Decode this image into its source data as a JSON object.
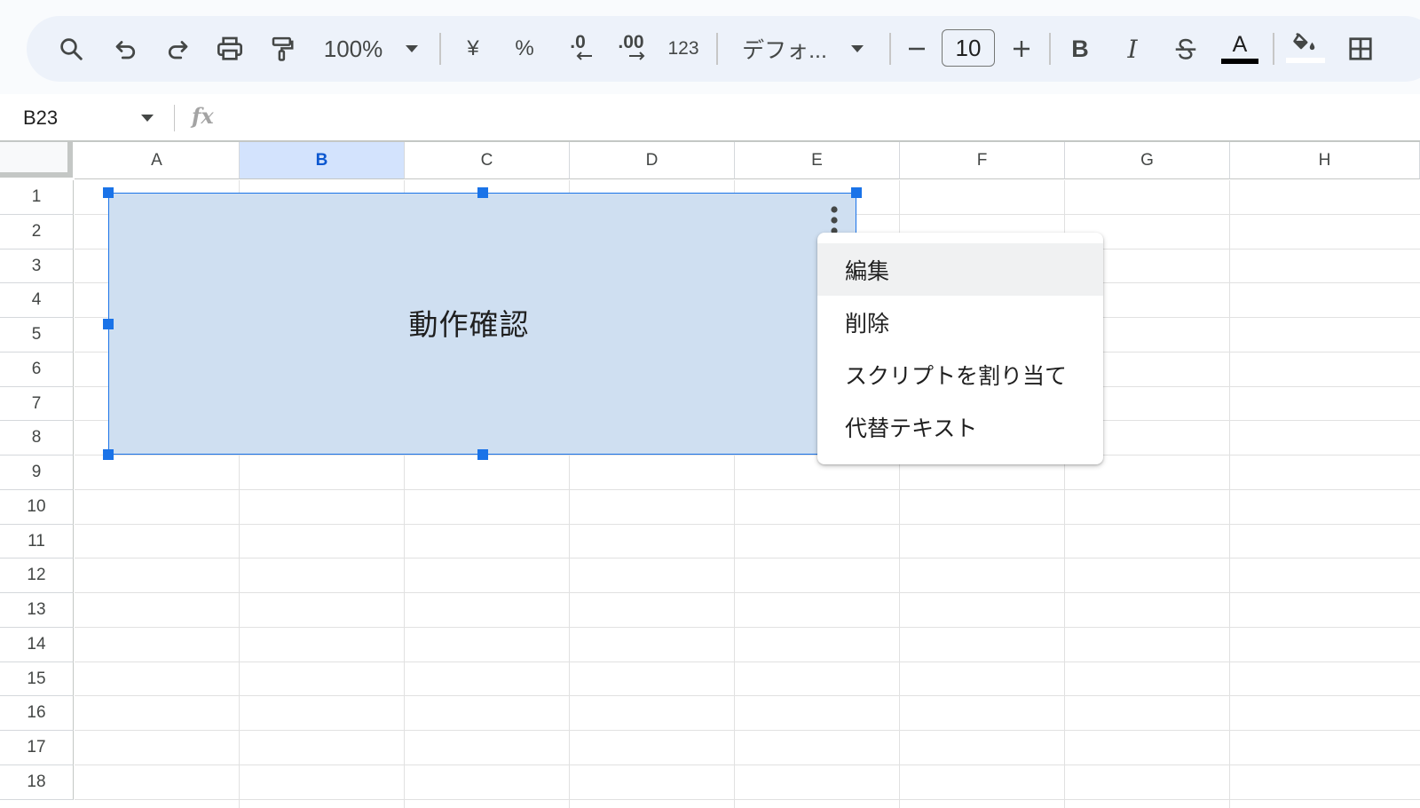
{
  "toolbar": {
    "zoom": "100%",
    "currency": "¥",
    "percent": "%",
    "decrease_decimal": ".0",
    "increase_decimal": ".00",
    "number_format": "123",
    "font": "デフォ...",
    "font_size": "10",
    "bold": "B",
    "italic": "I",
    "text_color_letter": "A",
    "text_color": "#000000",
    "fill_color": "#ffffff",
    "icons": [
      "search-icon",
      "undo-icon",
      "redo-icon",
      "print-icon",
      "paint-format-icon",
      "zoom-dropdown-icon",
      "font-dropdown-icon",
      "minus-icon",
      "plus-icon",
      "strikethrough-icon",
      "fill-color-icon",
      "borders-icon"
    ]
  },
  "formula_bar": {
    "name_box": "B23",
    "fx": "fx",
    "value": ""
  },
  "grid": {
    "columns": [
      "A",
      "B",
      "C",
      "D",
      "E",
      "F",
      "G",
      "H"
    ],
    "selected_column": "B",
    "rows": [
      "1",
      "2",
      "3",
      "4",
      "5",
      "6",
      "7",
      "8",
      "9",
      "10",
      "11",
      "12",
      "13",
      "14",
      "15",
      "16",
      "17",
      "18"
    ]
  },
  "drawing": {
    "label": "動作確認",
    "fill": "#cfdff1",
    "selection_color": "#1a73e8"
  },
  "context_menu": {
    "items": [
      "編集",
      "削除",
      "スクリプトを割り当て",
      "代替テキスト"
    ],
    "highlighted": "編集"
  },
  "colors": {
    "toolbar_bg": "#edf2fa",
    "selected_header_bg": "#d3e3fd",
    "accent": "#1a73e8"
  }
}
